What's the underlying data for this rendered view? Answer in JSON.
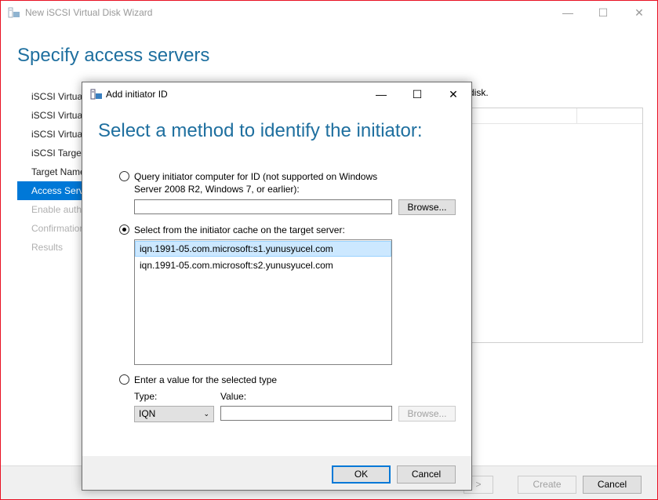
{
  "wizard": {
    "title": "New iSCSI Virtual Disk Wizard",
    "heading": "Specify access servers",
    "nav": [
      {
        "label": "iSCSI Virtual Disk Location",
        "state": "normal"
      },
      {
        "label": "iSCSI Virtual Disk Name",
        "state": "normal"
      },
      {
        "label": "iSCSI Virtual Disk Size",
        "state": "normal"
      },
      {
        "label": "iSCSI Target",
        "state": "normal"
      },
      {
        "label": "Target Name and Access",
        "state": "normal"
      },
      {
        "label": "Access Servers",
        "state": "active"
      },
      {
        "label": "Enable authentication",
        "state": "disabled"
      },
      {
        "label": "Confirmation",
        "state": "disabled"
      },
      {
        "label": "Results",
        "state": "disabled"
      }
    ],
    "description_tail": "disk.",
    "footer": {
      "next_label": ">",
      "create_label": "Create",
      "cancel_label": "Cancel"
    }
  },
  "dialog": {
    "title": "Add initiator ID",
    "heading": "Select a method to identify the initiator:",
    "option_query": {
      "label_line1": "Query initiator computer for ID (not supported on Windows",
      "label_line2": "Server 2008 R2, Windows 7, or earlier):",
      "value": "",
      "browse_label": "Browse..."
    },
    "option_cache": {
      "label": "Select from the initiator cache on the target server:",
      "items": [
        "iqn.1991-05.com.microsoft:s1.yunusyucel.com",
        "iqn.1991-05.com.microsoft:s2.yunusyucel.com"
      ],
      "selected_index": 0
    },
    "option_enter": {
      "label": "Enter a value for the selected type",
      "type_label": "Type:",
      "type_value": "IQN",
      "value_label": "Value:",
      "value": "",
      "browse_label": "Browse..."
    },
    "selected_option": "cache",
    "ok_label": "OK",
    "cancel_label": "Cancel"
  },
  "colors": {
    "accent": "#0078d7",
    "heading": "#1e6f9f",
    "selection": "#cce8ff"
  }
}
